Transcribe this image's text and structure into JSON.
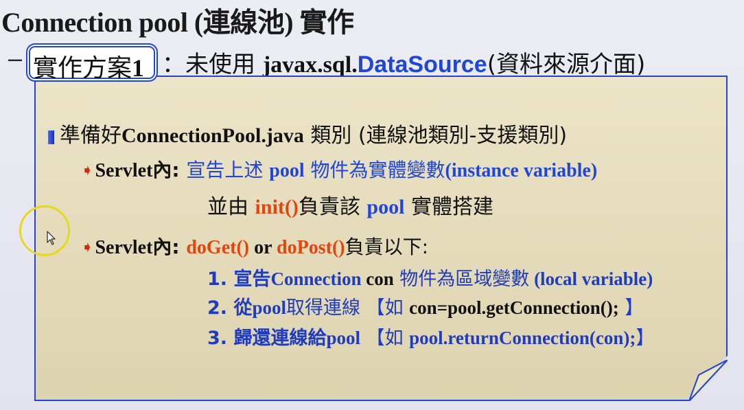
{
  "title": "Connection pool (連線池) 實作",
  "heading": {
    "dash": "–",
    "plan_label": "實作方案",
    "plan_number": "1",
    "subtitle_prefix": "：未使用 ",
    "subtitle_code": "javax.sql.",
    "subtitle_ds": "DataSource",
    "subtitle_suffix": "(資料來源介面)"
  },
  "content": {
    "line1": {
      "a": "準備好",
      "b": "ConnectionPool.java",
      "c": " 類別  (連線池類別-支援類別)"
    },
    "line2": {
      "label": "Servlet",
      "label_cjk": "內: ",
      "a": "宣告上述 ",
      "b": "pool",
      "c": " 物件為實體變數",
      "d": "(instance variable)"
    },
    "line3": {
      "a": "並由 ",
      "b": "init()",
      "c": "負責該 ",
      "d": "pool",
      "e": " 實體搭建"
    },
    "line4": {
      "label": "Servlet",
      "label_cjk": "內: ",
      "a": "doGet()",
      "b": " or ",
      "c": "doPost()",
      "d": "負責以下:"
    },
    "line5": {
      "a": "1. 宣告",
      "b": "Connection",
      "c": " con",
      "d": " 物件為區域變數",
      "e": " (local variable)"
    },
    "line6": {
      "a": "2. 從",
      "b": "pool",
      "c": "取得連線 【如 ",
      "d": "con=pool.getConnection();",
      "e": "    】"
    },
    "line7": {
      "a": "3. 歸還連線給",
      "b": "pool",
      "c": " 【如 ",
      "d": "pool.returnConnection(con);",
      "e": "】"
    }
  },
  "colors": {
    "accent_blue": "#1f46d8",
    "accent_red": "#e3450f",
    "panel": "#e6ddbd",
    "cursor_highlight": "#e8d81a"
  },
  "icons": [
    "square-bullet-icon",
    "red-arrow-icon",
    "mouse-cursor-icon"
  ]
}
